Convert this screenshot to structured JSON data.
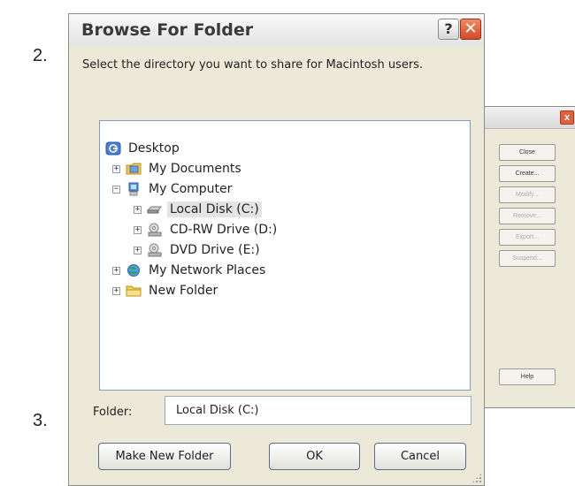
{
  "steps": {
    "step2": "2.",
    "step3": "3."
  },
  "dialog": {
    "title": "Browse For Folder",
    "help_glyph": "?",
    "close_glyph": "✕",
    "instruction": "Select the directory you want to share for Macintosh users.",
    "tree": [
      {
        "label": "Desktop",
        "icon": "desktop-icon"
      },
      {
        "label": "My Documents",
        "icon": "my-documents-icon",
        "expander": "+"
      },
      {
        "label": "My Computer",
        "icon": "computer-icon",
        "expander": "−"
      },
      {
        "label": "Local Disk (C:)",
        "icon": "hard-disk-icon",
        "expander": "+",
        "selected": true
      },
      {
        "label": "CD-RW Drive (D:)",
        "icon": "cd-drive-icon",
        "expander": "+"
      },
      {
        "label": "DVD Drive (E:)",
        "icon": "dvd-drive-icon",
        "expander": "+"
      },
      {
        "label": "My Network Places",
        "icon": "network-places-icon",
        "expander": "+"
      },
      {
        "label": "New Folder",
        "icon": "folder-icon",
        "expander": "+"
      }
    ],
    "folder_label": "Folder:",
    "folder_value": "Local Disk (C:)",
    "make_new_folder": "Make New Folder",
    "ok": "OK",
    "cancel": "Cancel"
  },
  "background_window": {
    "close_glyph": "x",
    "buttons": {
      "close": "Close",
      "create": "Create...",
      "modify": "Modify...",
      "remove": "Remove...",
      "export": "Export...",
      "suspend": "Suspend...",
      "help": "Help"
    }
  },
  "colors": {
    "dialog_bg": "#ece9d8",
    "close_red": "#d24a2a",
    "tree_border": "#7f9db9",
    "selection": "#e4e4e4"
  }
}
